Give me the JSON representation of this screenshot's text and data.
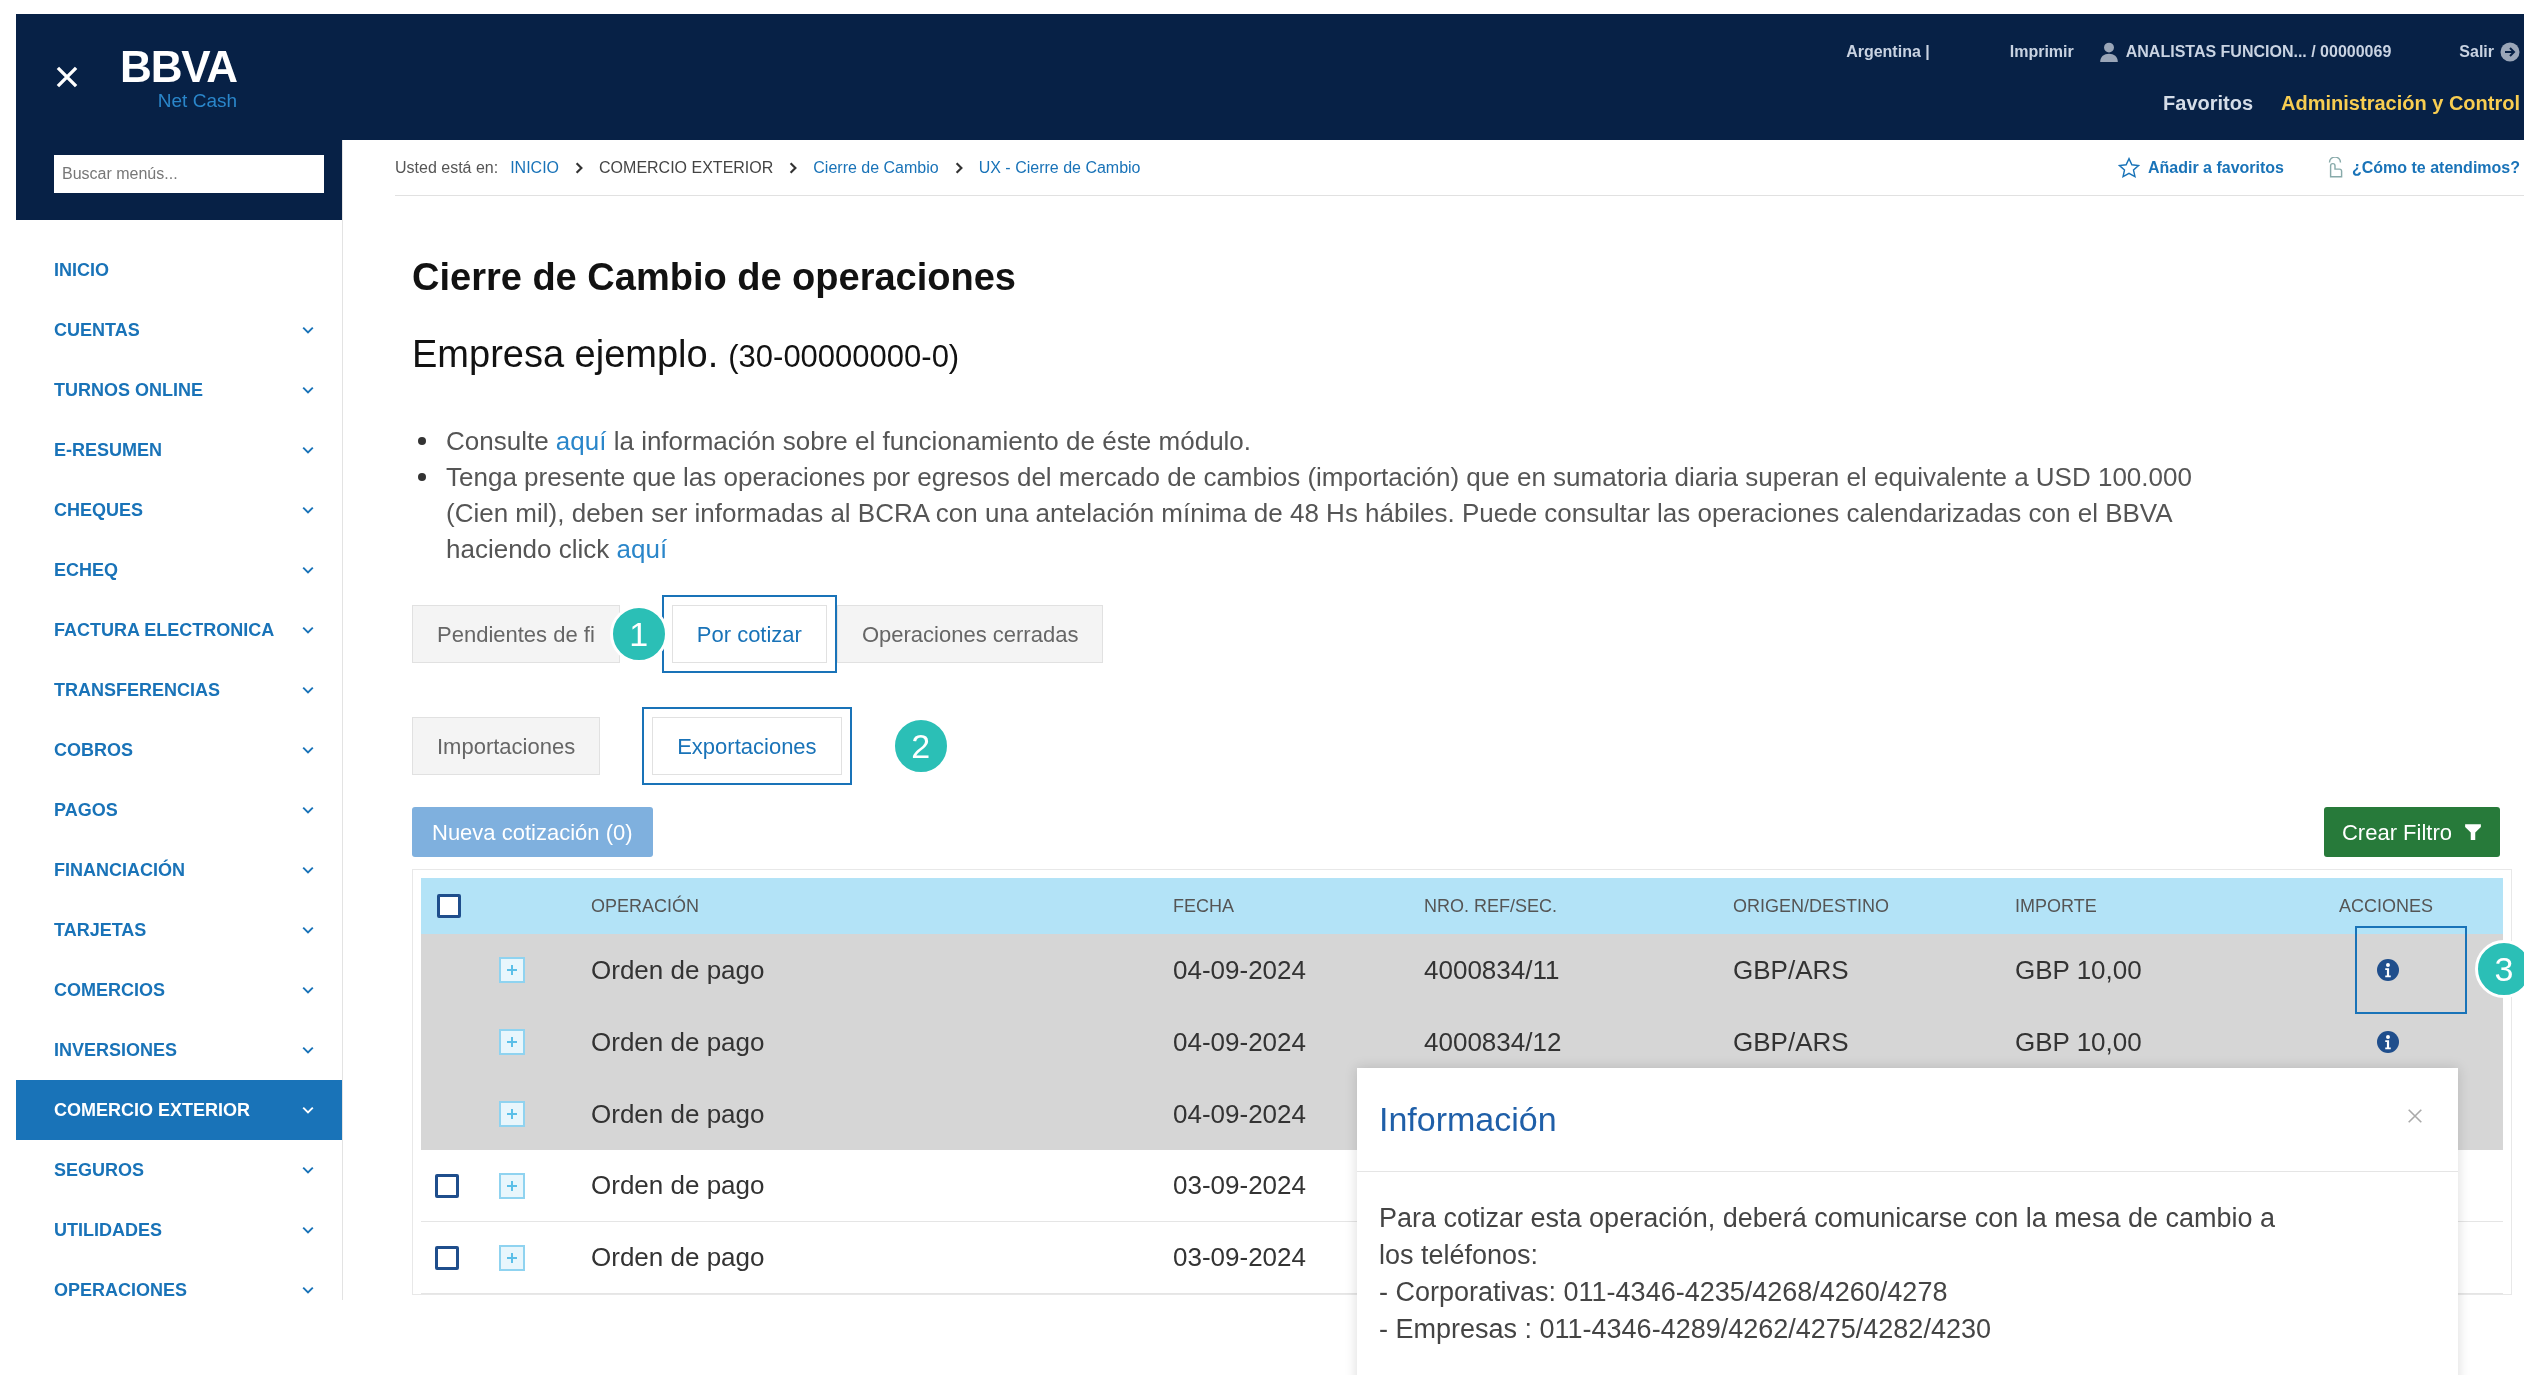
{
  "header": {
    "brand": "BBVA",
    "product": "Net Cash",
    "country": "Argentina |",
    "print": "Imprimir",
    "user": "ANALISTAS FUNCION... / 00000069",
    "logout": "Salir",
    "nav": [
      {
        "label": "Favoritos",
        "selected": false
      },
      {
        "label": "Administración y Control",
        "selected": true
      }
    ]
  },
  "sidebar": {
    "search": {
      "placeholder": "Buscar menús..."
    },
    "items": [
      {
        "label": "INICIO",
        "expandable": false,
        "selected": false
      },
      {
        "label": "CUENTAS",
        "expandable": true,
        "selected": false
      },
      {
        "label": "TURNOS ONLINE",
        "expandable": true,
        "selected": false
      },
      {
        "label": "E-RESUMEN",
        "expandable": true,
        "selected": false
      },
      {
        "label": "CHEQUES",
        "expandable": true,
        "selected": false
      },
      {
        "label": "ECHEQ",
        "expandable": true,
        "selected": false
      },
      {
        "label": "FACTURA ELECTRONICA",
        "expandable": true,
        "selected": false
      },
      {
        "label": "TRANSFERENCIAS",
        "expandable": true,
        "selected": false
      },
      {
        "label": "COBROS",
        "expandable": true,
        "selected": false
      },
      {
        "label": "PAGOS",
        "expandable": true,
        "selected": false
      },
      {
        "label": "FINANCIACIÓN",
        "expandable": true,
        "selected": false
      },
      {
        "label": "TARJETAS",
        "expandable": true,
        "selected": false
      },
      {
        "label": "COMERCIOS",
        "expandable": true,
        "selected": false
      },
      {
        "label": "INVERSIONES",
        "expandable": true,
        "selected": false
      },
      {
        "label": "COMERCIO EXTERIOR",
        "expandable": true,
        "selected": true
      },
      {
        "label": "SEGUROS",
        "expandable": true,
        "selected": false
      },
      {
        "label": "UTILIDADES",
        "expandable": true,
        "selected": false
      },
      {
        "label": "OPERACIONES",
        "expandable": true,
        "selected": false
      }
    ]
  },
  "breadcrumb": {
    "prefix": "Usted está en:",
    "items": [
      {
        "label": "INICIO",
        "link": true
      },
      {
        "label": "COMERCIO EXTERIOR",
        "link": false
      },
      {
        "label": "Cierre de Cambio",
        "link": true
      },
      {
        "label": "UX - Cierre de Cambio",
        "link": true
      }
    ],
    "add_favorites": "Añadir a favoritos",
    "help": "¿Cómo te atendimos?"
  },
  "page": {
    "title": "Cierre de Cambio de operaciones",
    "company": "Empresa ejemplo.",
    "company_id": "(30-00000000-0)",
    "notes": [
      [
        {
          "text": "Consulte ",
          "kind": "text"
        },
        {
          "text": "aquí",
          "kind": "link"
        },
        {
          "text": " la información sobre el funcionamiento de éste módulo.",
          "kind": "text"
        }
      ],
      [
        {
          "text": "Tenga presente que las operaciones por egresos del mercado de cambios (importación) que en sumatoria diaria superan el equivalente a USD 100.000 (Cien mil), deben ser informadas al BCRA con una antelación mínima de 48 Hs hábiles. Puede consultar las operaciones calendarizadas con el BBVA haciendo click ",
          "kind": "text"
        },
        {
          "text": "aquí",
          "kind": "link"
        }
      ]
    ]
  },
  "tabs": [
    {
      "label": "Pendientes de fi",
      "selected": false
    },
    {
      "label": "Por cotizar",
      "selected": true,
      "marker": "1"
    },
    {
      "label": "Operaciones cerradas",
      "selected": false
    }
  ],
  "subtabs": [
    {
      "label": "Importaciones",
      "selected": false
    },
    {
      "label": "Exportaciones",
      "selected": true,
      "marker": "2"
    }
  ],
  "new_quote_button": {
    "label": "Nueva cotización (0)",
    "disabled": true
  },
  "filter_button": "Crear Filtro",
  "table": {
    "select_all_checked": false,
    "columns": [
      "OPERACIÓN",
      "FECHA",
      "NRO. REF/SEC.",
      "ORIGEN/DESTINO",
      "IMPORTE",
      "ACCIONES"
    ],
    "rows": [
      {
        "highlighted": true,
        "operation": "Orden de pago",
        "date": "04-09-2024",
        "ref": "4000834/11",
        "pair": "GBP/ARS",
        "amount": "GBP 10,00",
        "info": true,
        "marker": "3"
      },
      {
        "highlighted": true,
        "operation": "Orden de pago",
        "date": "04-09-2024",
        "ref": "4000834/12",
        "pair": "GBP/ARS",
        "amount": "GBP 10,00",
        "info": true
      },
      {
        "highlighted": true,
        "operation": "Orden de pago",
        "date": "04-09-2024",
        "info": false
      },
      {
        "highlighted": false,
        "checked": false,
        "operation": "Orden de pago",
        "date": "03-09-2024",
        "info": false
      },
      {
        "highlighted": false,
        "checked": false,
        "operation": "Orden de pago",
        "date": "03-09-2024",
        "info": false
      }
    ]
  },
  "dialog": {
    "title": "Información",
    "lines": [
      "Para cotizar esta operación, deberá comunicarse con la mesa de cambio a los teléfonos:",
      "- Corporativas: 011-4346-4235/4268/4260/4278",
      "- Empresas : 011-4346-4289/4262/4275/4282/4230"
    ]
  }
}
